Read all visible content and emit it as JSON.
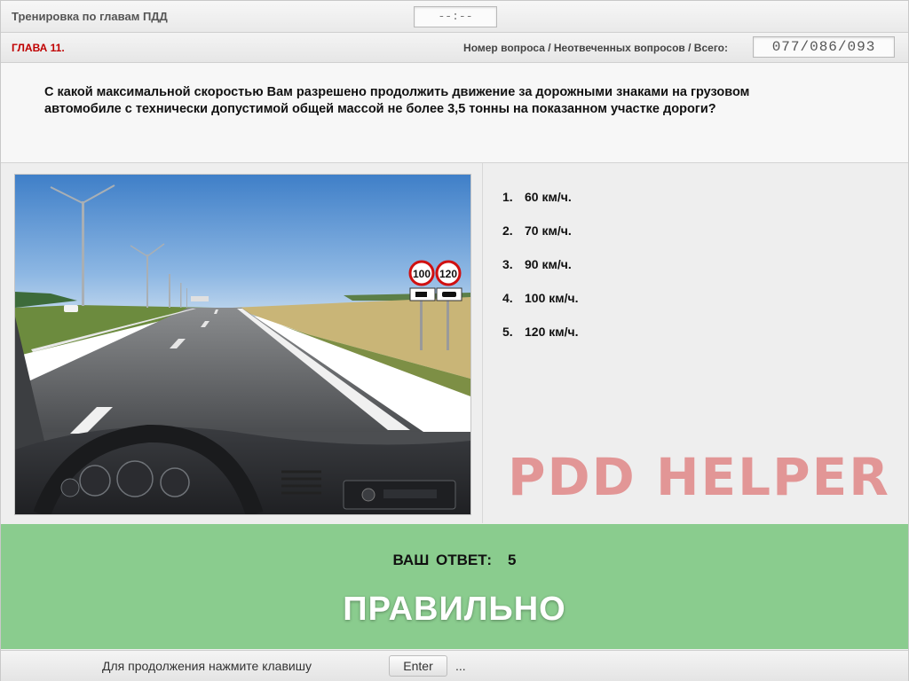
{
  "app_title": "Тренировка по главам ПДД",
  "timer": "--:--",
  "chapter": "ГЛАВА 11.",
  "counter": {
    "label": "Номер вопроса / Неотвеченных вопросов / Всего:",
    "value": "077/086/093"
  },
  "question": "С какой максимальной скоростью Вам разрешено продолжить движение за дорожными знаками на грузовом автомобиле с технически допустимой общей массой не более 3,5 тонны на показанном участке дороги?",
  "scene": {
    "sign_truck_speed": "100",
    "sign_car_speed": "120"
  },
  "answers": [
    {
      "num": "1.",
      "text": "60 км/ч."
    },
    {
      "num": "2.",
      "text": "70 км/ч."
    },
    {
      "num": "3.",
      "text": "90 км/ч."
    },
    {
      "num": "4.",
      "text": "100 км/ч."
    },
    {
      "num": "5.",
      "text": "120 км/ч."
    }
  ],
  "watermark": "PDD HELPER",
  "result": {
    "your_answer_label": "ВАШ ОТВЕТ:",
    "your_answer_value": "5",
    "verdict": "ПРАВИЛЬНО",
    "color": "#8acc8e"
  },
  "footer": {
    "hint": "Для продолжения нажмите клавишу",
    "key": "Enter",
    "dots": "..."
  }
}
